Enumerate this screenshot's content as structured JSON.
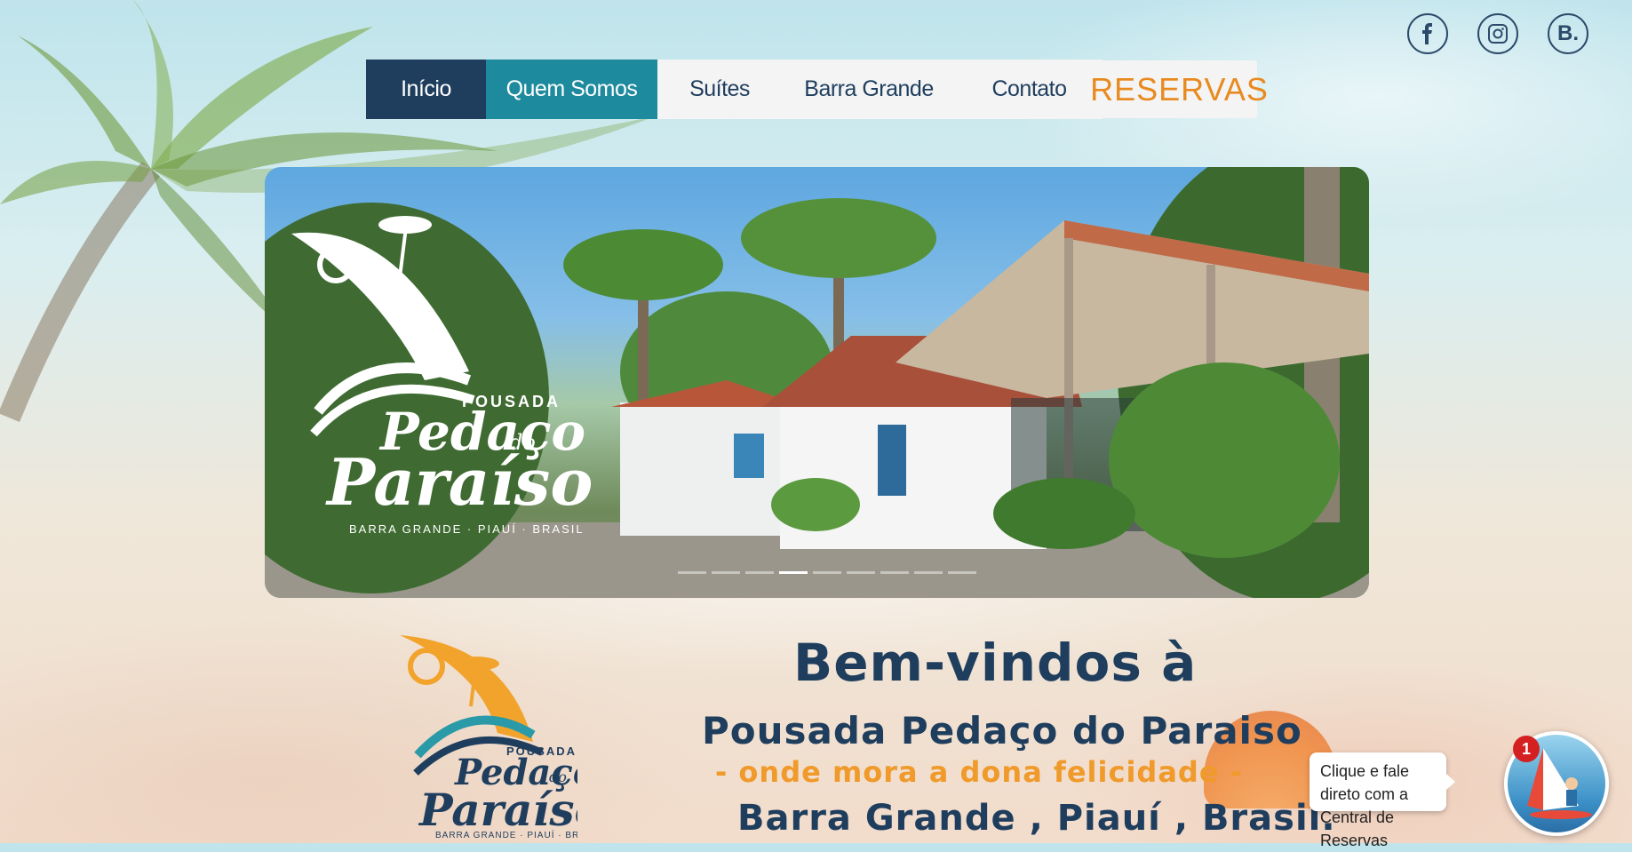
{
  "social": {
    "facebook_icon": "facebook-icon",
    "instagram_icon": "instagram-icon",
    "booking_label": "B."
  },
  "nav": {
    "items": [
      {
        "label": "Início"
      },
      {
        "label": "Quem Somos"
      },
      {
        "label": "Suítes"
      },
      {
        "label": "Barra Grande"
      },
      {
        "label": "Contato"
      }
    ],
    "reservas_label": "RESERVAS"
  },
  "slider": {
    "logo": {
      "top": "POUSADA",
      "name_line1": "Pedaço",
      "name_small": "do",
      "name_line2": "Paraíso",
      "location": "BARRA GRANDE · PIAUÍ · BRASIL"
    },
    "active_slide_index": 3,
    "slide_count": 9
  },
  "welcome": {
    "line1": "Bem-vindos à",
    "line2": "Pousada Pedaço do Paraiso",
    "line3": "- onde mora a dona felicidade -",
    "line4": "Barra Grande , Piauí , Brasil.",
    "logo": {
      "top": "POUSADA",
      "name_line1": "Pedaço",
      "name_small": "do",
      "name_line2": "Paraíso",
      "location": "BARRA GRANDE · PIAUÍ · BRASIL"
    }
  },
  "chat": {
    "line1": "Clique e fale direto com a",
    "line2": "Central de Reservas",
    "badge": "1"
  },
  "colors": {
    "navy": "#1f3e5e",
    "teal": "#1e8a9e",
    "orange": "#ef9a2a",
    "badge_red": "#d42020"
  }
}
